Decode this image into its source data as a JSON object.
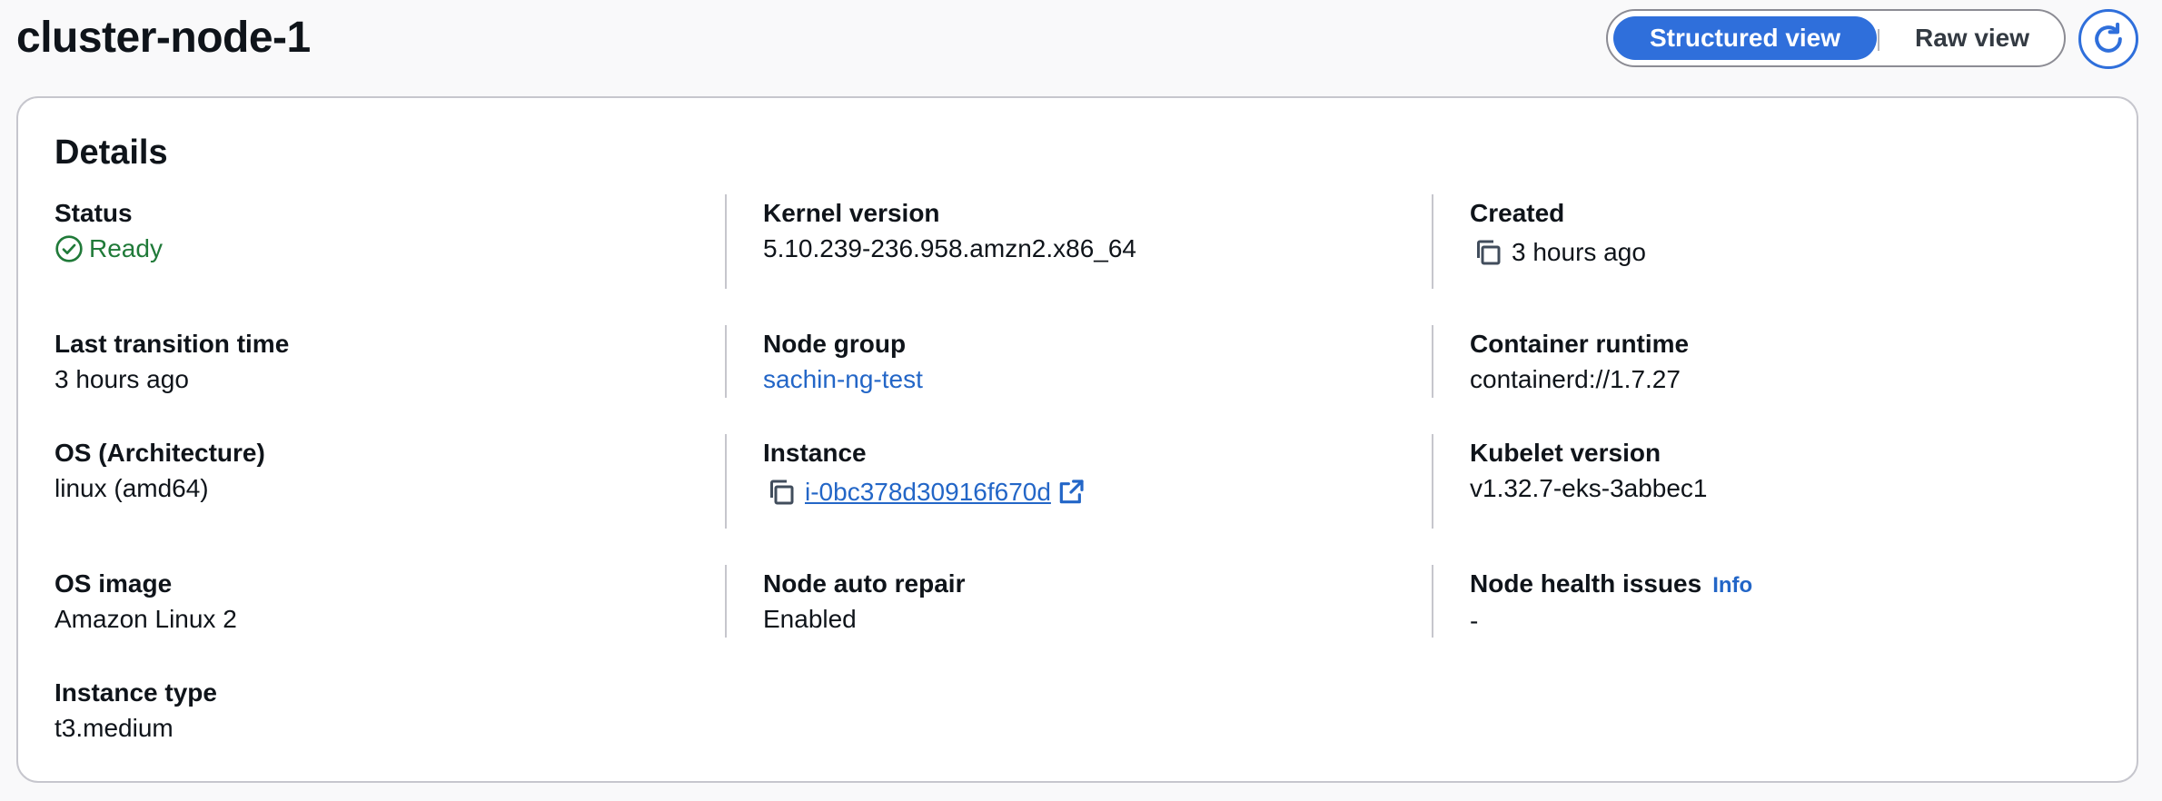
{
  "header": {
    "title": "cluster-node-1",
    "view_toggle": {
      "structured_label": "Structured view",
      "raw_label": "Raw view",
      "selected": "Structured view"
    },
    "refresh_icon": "refresh-icon"
  },
  "details": {
    "title": "Details",
    "status": {
      "label": "Status",
      "value": "Ready",
      "color": "#207a39"
    },
    "last_transition_time": {
      "label": "Last transition time",
      "value": "3 hours ago"
    },
    "os_architecture": {
      "label": "OS (Architecture)",
      "value": "linux (amd64)"
    },
    "os_image": {
      "label": "OS image",
      "value": "Amazon Linux 2"
    },
    "instance_type": {
      "label": "Instance type",
      "value": "t3.medium"
    },
    "kernel_version": {
      "label": "Kernel version",
      "value": "5.10.239-236.958.amzn2.x86_64"
    },
    "node_group": {
      "label": "Node group",
      "value": "sachin-ng-test"
    },
    "instance": {
      "label": "Instance",
      "value": "i-0bc378d30916f670d"
    },
    "node_auto_repair": {
      "label": "Node auto repair",
      "value": "Enabled"
    },
    "created": {
      "label": "Created",
      "value": "3 hours ago"
    },
    "container_runtime": {
      "label": "Container runtime",
      "value": "containerd://1.7.27"
    },
    "kubelet_version": {
      "label": "Kubelet version",
      "value": "v1.32.7-eks-3abbec1"
    },
    "node_health_issues": {
      "label": "Node health issues",
      "info": "Info",
      "value": "-"
    }
  },
  "colors": {
    "accent": "#2f6fdb",
    "link": "#2366c7",
    "success": "#207a39"
  }
}
